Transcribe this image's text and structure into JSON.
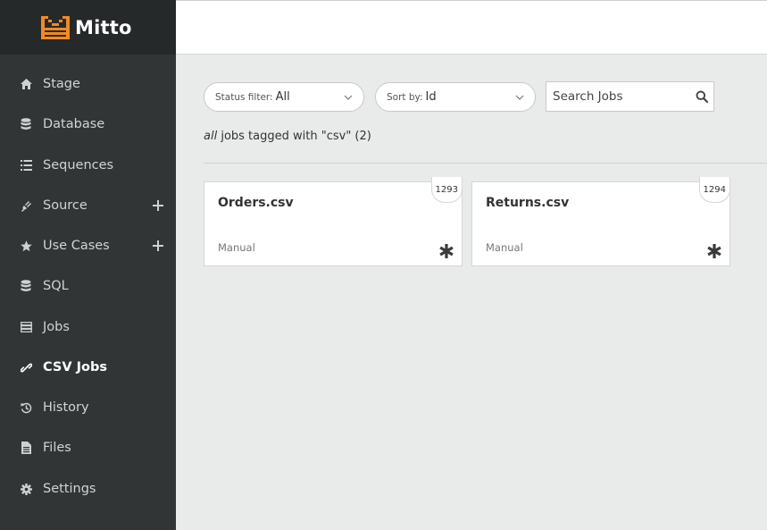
{
  "app": {
    "name": "Mitto",
    "brand_color": "#f08a24"
  },
  "sidebar": {
    "items": [
      {
        "label": "Stage",
        "icon": "home-icon",
        "active": false,
        "expandable": false
      },
      {
        "label": "Database",
        "icon": "database-icon",
        "active": false,
        "expandable": false
      },
      {
        "label": "Sequences",
        "icon": "list-icon",
        "active": false,
        "expandable": false
      },
      {
        "label": "Source",
        "icon": "plug-icon",
        "active": false,
        "expandable": true
      },
      {
        "label": "Use Cases",
        "icon": "star-icon",
        "active": false,
        "expandable": true
      },
      {
        "label": "SQL",
        "icon": "database-icon",
        "active": false,
        "expandable": false
      },
      {
        "label": "Jobs",
        "icon": "server-icon",
        "active": false,
        "expandable": false
      },
      {
        "label": "CSV Jobs",
        "icon": "link-icon",
        "active": true,
        "expandable": false
      },
      {
        "label": "History",
        "icon": "history-icon",
        "active": false,
        "expandable": false
      },
      {
        "label": "Files",
        "icon": "file-icon",
        "active": false,
        "expandable": false
      },
      {
        "label": "Settings",
        "icon": "gear-icon",
        "active": false,
        "expandable": false
      }
    ]
  },
  "filters": {
    "status_prefix": "Status filter:",
    "status_value": "All",
    "sort_prefix": "Sort by:",
    "sort_value": "Id"
  },
  "search": {
    "placeholder": "Search Jobs",
    "value": ""
  },
  "summary": {
    "scope": "all",
    "text": " jobs tagged with \"csv\" (2)"
  },
  "jobs": [
    {
      "title": "Orders.csv",
      "type": "Manual",
      "id": "1293"
    },
    {
      "title": "Returns.csv",
      "type": "Manual",
      "id": "1294"
    }
  ]
}
